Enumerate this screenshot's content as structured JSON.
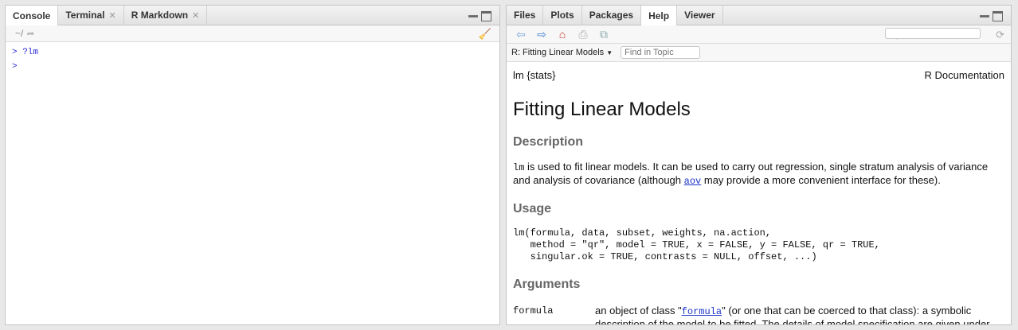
{
  "console_tabs": [
    {
      "label": "Console",
      "closable": false
    },
    {
      "label": "Terminal",
      "closable": true
    },
    {
      "label": "R Markdown",
      "closable": true
    }
  ],
  "console_path": "~/",
  "console_lines": [
    "> ?lm",
    ">"
  ],
  "help_tabs": [
    "Files",
    "Plots",
    "Packages",
    "Help",
    "Viewer"
  ],
  "help_active_tab": "Help",
  "topic_select": "R: Fitting Linear Models",
  "find_placeholder": "Find in Topic",
  "doc": {
    "pkg": "lm {stats}",
    "rdoc": "R Documentation",
    "title": "Fitting Linear Models",
    "desc_heading": "Description",
    "desc_code": "lm",
    "desc_text1": " is used to fit linear models. It can be used to carry out regression, single stratum analysis of variance and analysis of covariance (although ",
    "desc_link": "aov",
    "desc_text2": " may provide a more convenient interface for these).",
    "usage_heading": "Usage",
    "usage_code": "lm(formula, data, subset, weights, na.action,\n   method = \"qr\", model = TRUE, x = FALSE, y = FALSE, qr = TRUE,\n   singular.ok = TRUE, contrasts = NULL, offset, ...)",
    "args_heading": "Arguments",
    "arg_name": "formula",
    "arg_text1": "an object of class \"",
    "arg_link": "formula",
    "arg_text2": "\" (or one that can be coerced to that class): a symbolic description of the model to be fitted. The details of model specification are given under"
  },
  "colors": {
    "link": "#1a33c8",
    "console_text": "#2a2ad4",
    "heading": "#666666"
  }
}
